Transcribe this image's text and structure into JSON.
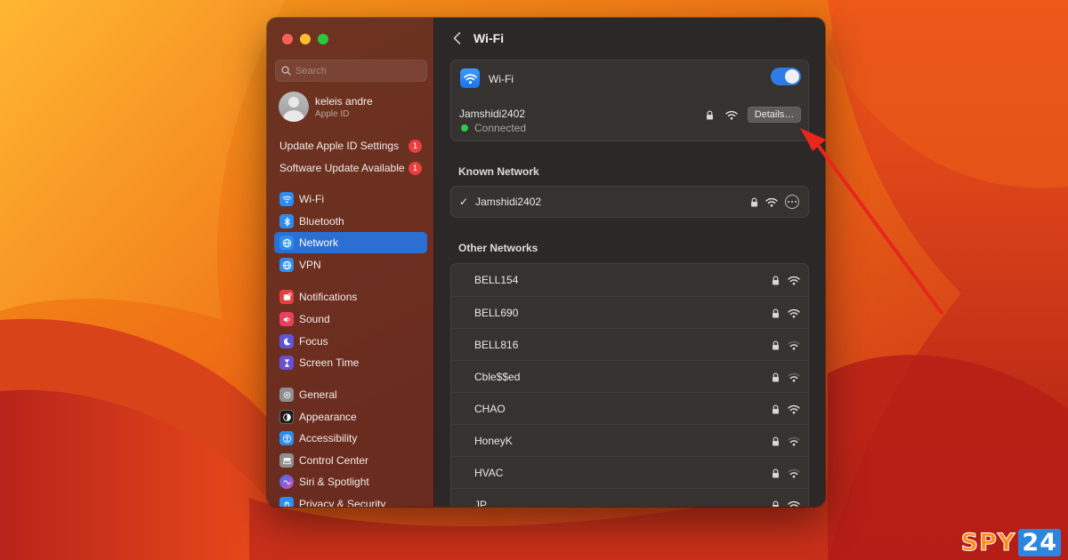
{
  "colors": {
    "accent": "#2b6fd3",
    "badge": "#e8403e",
    "connected": "#30c84e",
    "arrow": "#e8261c"
  },
  "sidebar": {
    "search_placeholder": "Search",
    "account": {
      "name": "keleis andre",
      "subtitle": "Apple ID"
    },
    "notices": [
      {
        "label": "Update Apple ID Settings",
        "badge": "1"
      },
      {
        "label": "Software Update Available",
        "badge": "1"
      }
    ],
    "items": [
      {
        "label": "Wi-Fi",
        "icon": "wifi-icon",
        "color": "#2d8cf0"
      },
      {
        "label": "Bluetooth",
        "icon": "bluetooth-icon",
        "color": "#2d8cf0"
      },
      {
        "label": "Network",
        "icon": "globe-icon",
        "color": "#2d8cf0",
        "active": true
      },
      {
        "label": "VPN",
        "icon": "vpn-globe-icon",
        "color": "#2d8cf0"
      },
      {
        "label": "Notifications",
        "icon": "bell-icon",
        "color": "#e8403e"
      },
      {
        "label": "Sound",
        "icon": "speaker-icon",
        "color": "#e8405a"
      },
      {
        "label": "Focus",
        "icon": "moon-icon",
        "color": "#5e55d6"
      },
      {
        "label": "Screen Time",
        "icon": "hourglass-icon",
        "color": "#6a4fd0"
      },
      {
        "label": "General",
        "icon": "gear-icon",
        "color": "#8e8e8e"
      },
      {
        "label": "Appearance",
        "icon": "appearance-icon",
        "color": "#1a1a1a"
      },
      {
        "label": "Accessibility",
        "icon": "accessibility-icon",
        "color": "#2d8cf0"
      },
      {
        "label": "Control Center",
        "icon": "control-center-icon",
        "color": "#8e8e8e"
      },
      {
        "label": "Siri & Spotlight",
        "icon": "siri-icon",
        "color": "#b04fd0"
      },
      {
        "label": "Privacy & Security",
        "icon": "hand-icon",
        "color": "#2d8cf0"
      }
    ]
  },
  "main": {
    "title": "Wi-Fi",
    "wifi": {
      "label": "Wi-Fi",
      "enabled": true,
      "current_network": "Jamshidi2402",
      "status": "Connected",
      "details_label": "Details…"
    },
    "known_title": "Known Network",
    "known_networks": [
      {
        "name": "Jamshidi2402",
        "checked": "✓"
      }
    ],
    "others_title": "Other Networks",
    "other_networks": [
      {
        "name": "BELL154",
        "signal": "strong"
      },
      {
        "name": "BELL690",
        "signal": "strong"
      },
      {
        "name": "BELL816",
        "signal": "weak"
      },
      {
        "name": "Cble$$ed",
        "signal": "weak"
      },
      {
        "name": "CHAO",
        "signal": "strong"
      },
      {
        "name": "HoneyK",
        "signal": "weak"
      },
      {
        "name": "HVAC",
        "signal": "weak"
      },
      {
        "name": "JP",
        "signal": "strong"
      }
    ]
  },
  "watermark": {
    "text": "SPY24"
  }
}
